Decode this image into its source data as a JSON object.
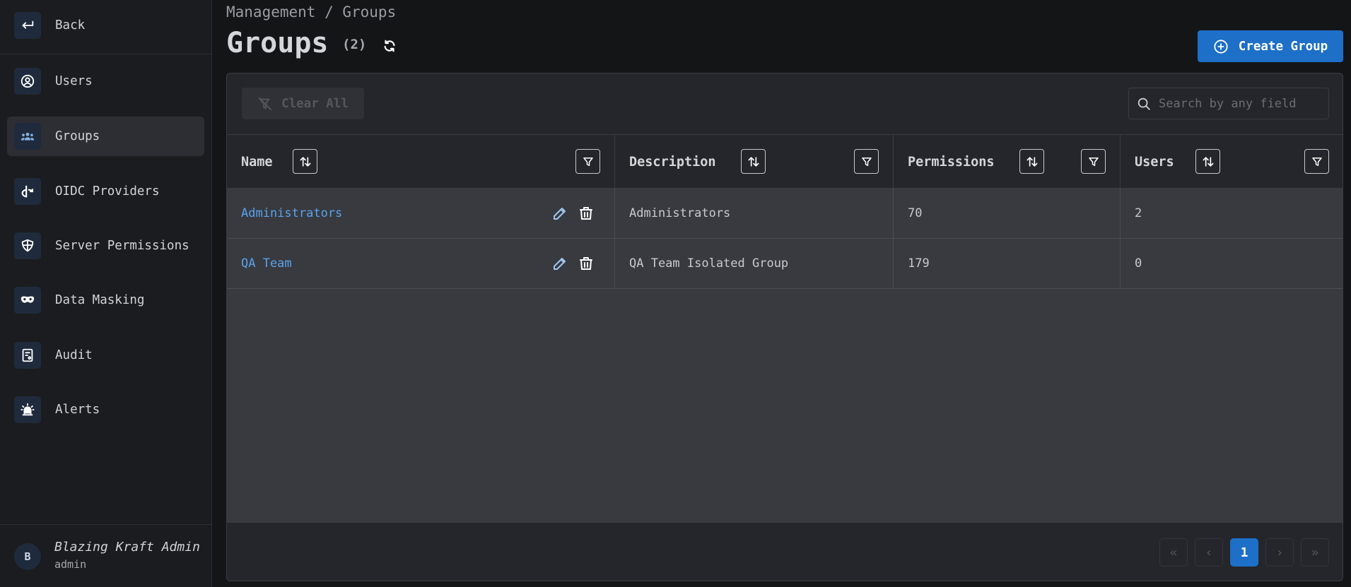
{
  "sidebar": {
    "back": "Back",
    "items": [
      {
        "label": "Users",
        "icon": "user-circle-icon"
      },
      {
        "label": "Groups",
        "icon": "users-group-icon"
      },
      {
        "label": "OIDC Providers",
        "icon": "openid-icon"
      },
      {
        "label": "Server Permissions",
        "icon": "shield-icon"
      },
      {
        "label": "Data Masking",
        "icon": "mask-icon"
      },
      {
        "label": "Audit",
        "icon": "report-icon"
      },
      {
        "label": "Alerts",
        "icon": "siren-icon"
      }
    ],
    "active": "Groups",
    "user": {
      "initial": "B",
      "name": "Blazing Kraft Admin",
      "role": "admin"
    }
  },
  "header": {
    "breadcrumb": "Management / Groups",
    "title": "Groups",
    "count": "(2)",
    "create_label": "Create Group"
  },
  "toolbar": {
    "clear_label": "Clear All",
    "search_placeholder": "Search by any field"
  },
  "table": {
    "columns": [
      "Name",
      "Description",
      "Permissions",
      "Users"
    ],
    "rows": [
      {
        "name": "Administrators",
        "description": "Administrators",
        "permissions": "70",
        "users": "2"
      },
      {
        "name": "QA Team",
        "description": "QA Team Isolated Group",
        "permissions": "179",
        "users": "0"
      }
    ]
  },
  "pagination": {
    "current": "1",
    "first": "«",
    "prev": "‹",
    "next": "›",
    "last": "»"
  },
  "colors": {
    "accent": "#1d6fc7",
    "link": "#5aa3ea",
    "background": "#141517"
  }
}
